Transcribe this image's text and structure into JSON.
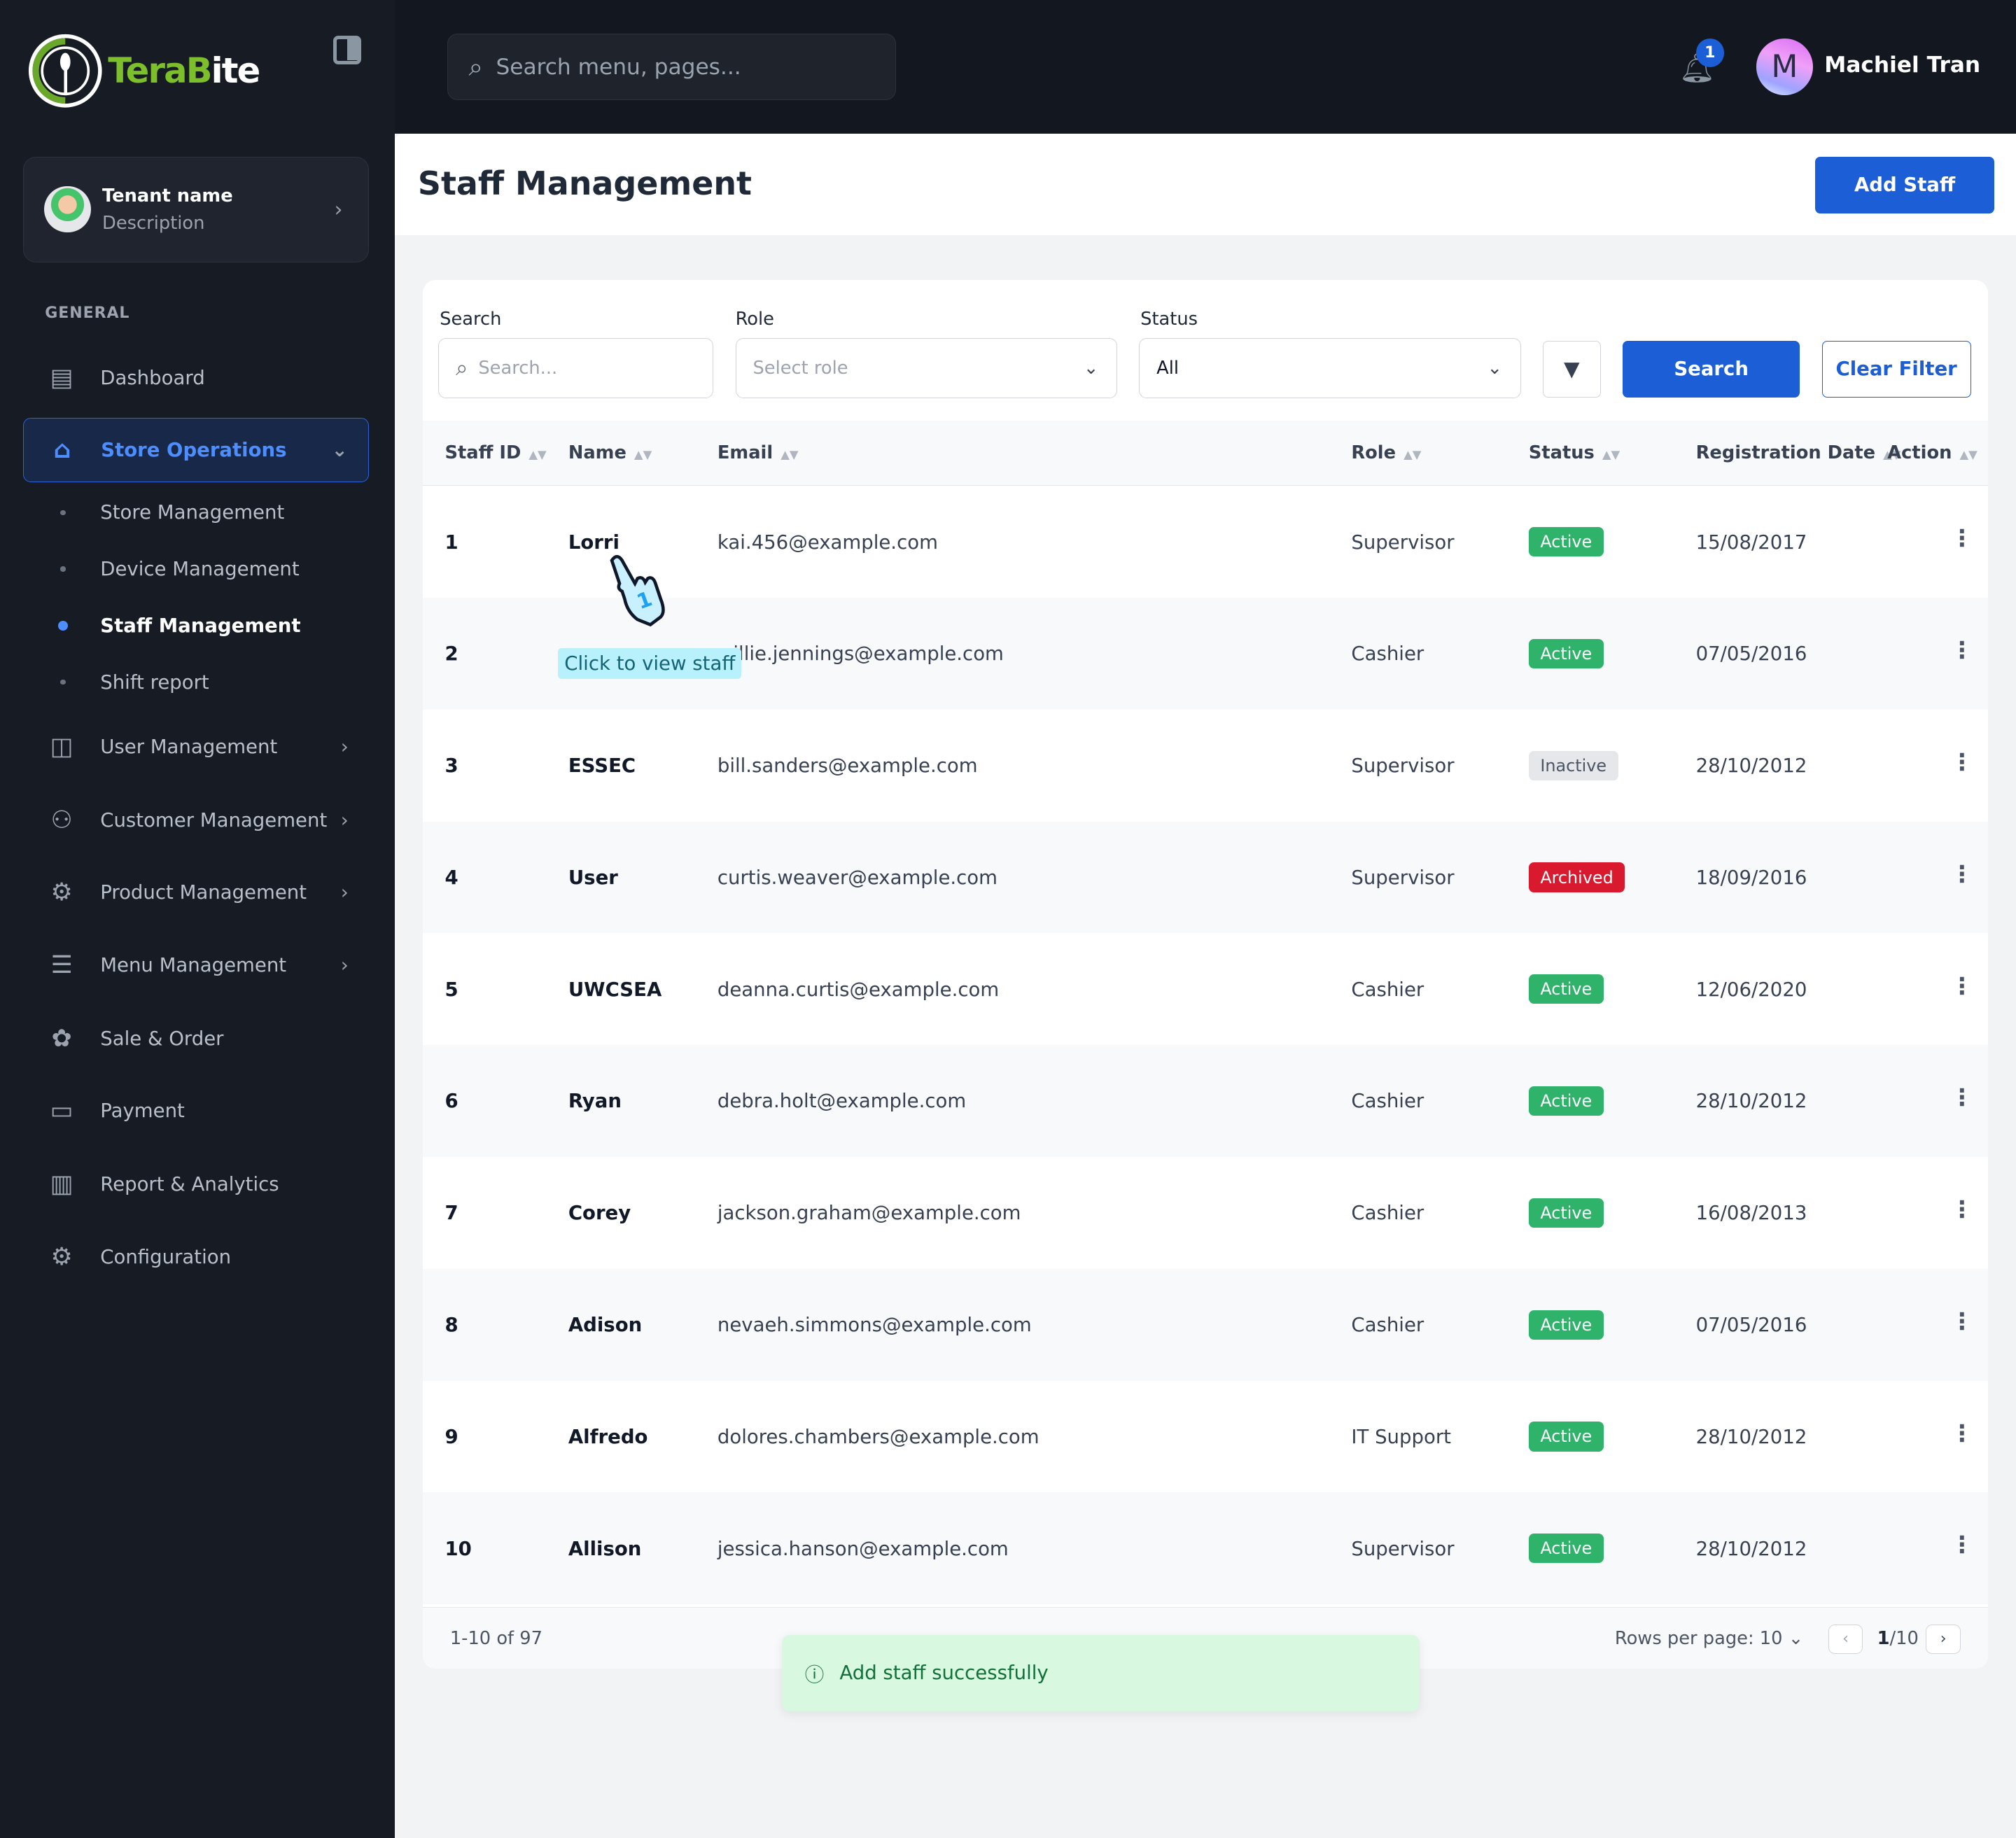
{
  "app": {
    "logo_prefix": "Tera",
    "logo_mid": "B",
    "logo_suffix": "ite"
  },
  "tenant": {
    "name": "Tenant name",
    "description": "Description"
  },
  "sidebar": {
    "section": "GENERAL",
    "items": [
      {
        "label": "Dashboard",
        "icon": "building-icon"
      },
      {
        "label": "Store Operations",
        "icon": "store-icon",
        "active": true
      },
      {
        "label": "User Management",
        "icon": "user-icon"
      },
      {
        "label": "Customer Management",
        "icon": "users-icon"
      },
      {
        "label": "Product Management",
        "icon": "gear-icon"
      },
      {
        "label": "Menu Management",
        "icon": "list-icon"
      },
      {
        "label": "Sale & Order",
        "icon": "discount-icon"
      },
      {
        "label": "Payment",
        "icon": "wallet-icon"
      },
      {
        "label": "Report & Analytics",
        "icon": "chart-icon"
      },
      {
        "label": "Configuration",
        "icon": "settings-icon"
      }
    ],
    "subitems": [
      {
        "label": "Store Management"
      },
      {
        "label": "Device Management"
      },
      {
        "label": "Staff Management",
        "active": true
      },
      {
        "label": "Shift report"
      }
    ]
  },
  "header": {
    "search_placeholder": "Search menu, pages...",
    "notification_count": "1",
    "user_initial": "M",
    "user_name": "Machiel Tran"
  },
  "page": {
    "title": "Staff Management",
    "add_button": "Add Staff"
  },
  "filters": {
    "search_label": "Search",
    "search_placeholder": "Search...",
    "role_label": "Role",
    "role_placeholder": "Select role",
    "status_label": "Status",
    "status_value": "All",
    "search_button": "Search",
    "clear_button": "Clear Filter"
  },
  "table": {
    "columns": [
      "Staff ID",
      "Name",
      "Email",
      "Role",
      "Status",
      "Registration Date",
      "Action"
    ],
    "rows": [
      {
        "id": "1",
        "name": "Lorri",
        "email": "kai.456@example.com",
        "role": "Supervisor",
        "status": "Active",
        "date": "15/08/2017"
      },
      {
        "id": "2",
        "name": "",
        "email": "willie.jennings@example.com",
        "role": "Cashier",
        "status": "Active",
        "date": "07/05/2016"
      },
      {
        "id": "3",
        "name": "ESSEC",
        "email": "bill.sanders@example.com",
        "role": "Supervisor",
        "status": "Inactive",
        "date": "28/10/2012"
      },
      {
        "id": "4",
        "name": "User",
        "email": "curtis.weaver@example.com",
        "role": "Supervisor",
        "status": "Archived",
        "date": "18/09/2016"
      },
      {
        "id": "5",
        "name": "UWCSEA",
        "email": "deanna.curtis@example.com",
        "role": "Cashier",
        "status": "Active",
        "date": "12/06/2020"
      },
      {
        "id": "6",
        "name": "Ryan",
        "email": "debra.holt@example.com",
        "role": "Cashier",
        "status": "Active",
        "date": "28/10/2012"
      },
      {
        "id": "7",
        "name": "Corey",
        "email": "jackson.graham@example.com",
        "role": "Cashier",
        "status": "Active",
        "date": "16/08/2013"
      },
      {
        "id": "8",
        "name": "Adison",
        "email": "nevaeh.simmons@example.com",
        "role": "Cashier",
        "status": "Active",
        "date": "07/05/2016"
      },
      {
        "id": "9",
        "name": "Alfredo",
        "email": "dolores.chambers@example.com",
        "role": "IT Support",
        "status": "Active",
        "date": "28/10/2012"
      },
      {
        "id": "10",
        "name": "Allison",
        "email": "jessica.hanson@example.com",
        "role": "Supervisor",
        "status": "Active",
        "date": "28/10/2012"
      }
    ],
    "status_colors": {
      "Active": "#2fb36b",
      "Inactive": "#e5e7eb",
      "Archived": "#d9192d"
    }
  },
  "pagination": {
    "range": "1-10 of 97",
    "rows_per_page_label": "Rows per page:",
    "rows_per_page": "10",
    "current": "1",
    "total": "/10"
  },
  "tooltip": "Click to view staff",
  "toast": {
    "message": "Add staff successfully"
  }
}
